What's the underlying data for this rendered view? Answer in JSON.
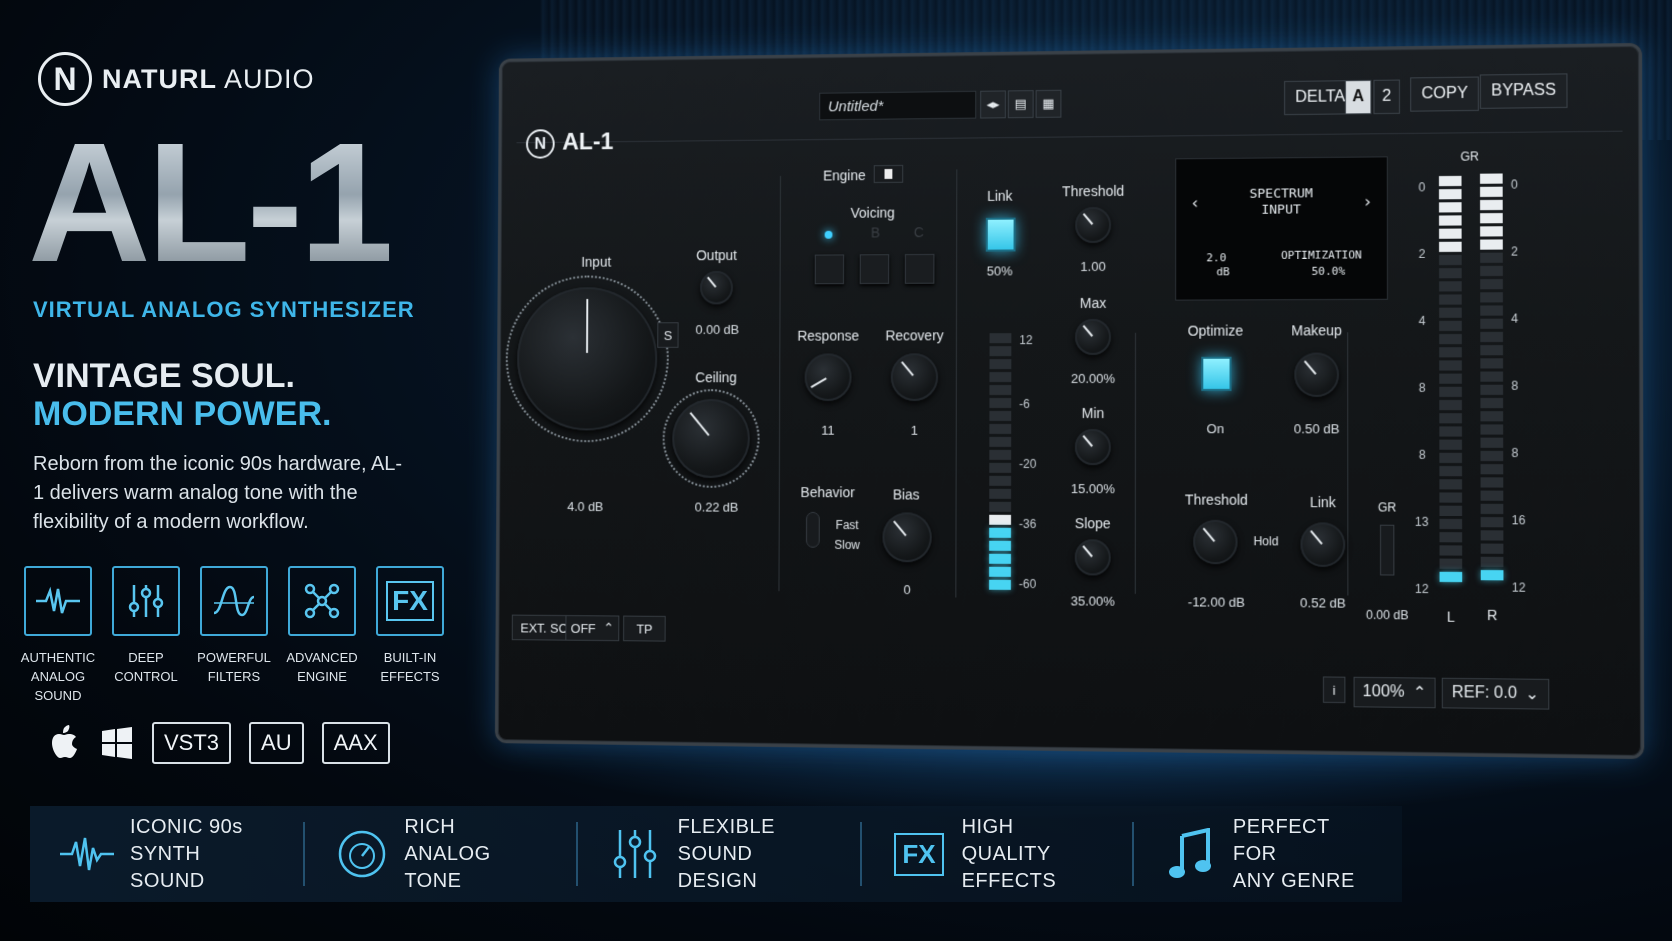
{
  "brand": {
    "name_bold": "NATURL",
    "name_light": " AUDIO",
    "logo_letter": "N"
  },
  "hero": {
    "title": "AL-1",
    "subtitle": "VIRTUAL ANALOG SYNTHESIZER",
    "tagline_line1": "VINTAGE SOUL.",
    "tagline_line2": "MODERN POWER.",
    "description": "Reborn from the iconic 90s hardware, AL-1 delivers warm analog tone with the flexibility of a modern workflow."
  },
  "features": [
    {
      "icon": "waveform-icon",
      "label_line1": "AUTHENTIC",
      "label_line2": "ANALOG SOUND"
    },
    {
      "icon": "sliders-icon",
      "label_line1": "DEEP",
      "label_line2": "CONTROL"
    },
    {
      "icon": "filter-icon",
      "label_line1": "POWERFUL",
      "label_line2": "FILTERS"
    },
    {
      "icon": "network-icon",
      "label_line1": "ADVANCED",
      "label_line2": "ENGINE"
    },
    {
      "icon": "fx-icon",
      "glyph": "FX",
      "label_line1": "BUILT-IN",
      "label_line2": "EFFECTS"
    }
  ],
  "platforms": {
    "apple": "apple-icon",
    "windows": "windows-icon",
    "formats": [
      "VST3",
      "AU",
      "AAX"
    ]
  },
  "bottom_bar": [
    {
      "icon": "waveform-icon",
      "line1": "ICONIC 90s",
      "line2": "SYNTH SOUND"
    },
    {
      "icon": "gauge-icon",
      "line1": "RICH",
      "line2": "ANALOG TONE"
    },
    {
      "icon": "sliders-icon",
      "line1": "FLEXIBLE",
      "line2": "SOUND DESIGN"
    },
    {
      "icon": "fx-icon",
      "line1": "HIGH QUALITY",
      "line2": "EFFECTS"
    },
    {
      "icon": "music-note-icon",
      "line1": "PERFECT FOR",
      "line2": "ANY GENRE"
    }
  ],
  "plugin": {
    "name": "AL-1",
    "preset_name": "Untitled*",
    "toolbar": {
      "delta": "DELTA",
      "a": "A",
      "b": "2",
      "copy": "COPY",
      "bypass": "BYPASS"
    },
    "input": {
      "label": "Input",
      "value": "4.0 dB"
    },
    "output": {
      "label": "Output",
      "value": "0.00 dB"
    },
    "ceiling": {
      "label": "Ceiling",
      "value": "0.22 dB"
    },
    "s_button": "S",
    "engine": {
      "label": "Engine"
    },
    "voicing": {
      "label": "Voicing",
      "options": [
        "A",
        "B",
        "C"
      ]
    },
    "response": {
      "label": "Response",
      "value": "11"
    },
    "recovery": {
      "label": "Recovery",
      "value": "1"
    },
    "behavior": {
      "label": "Behavior",
      "fast": "Fast",
      "slow": "Slow"
    },
    "bias": {
      "label": "Bias",
      "value": "0"
    },
    "link": {
      "label": "Link",
      "value": "50%"
    },
    "link_scale": [
      "12",
      "-6",
      "-20",
      "-36",
      "-60"
    ],
    "threshold": {
      "label": "Threshold",
      "value": "1.00"
    },
    "max": {
      "label": "Max",
      "value": "20.00%"
    },
    "min": {
      "label": "Min",
      "value": "15.00%"
    },
    "slope": {
      "label": "Slope",
      "value": "35.00%"
    },
    "display": {
      "line1": "SPECTRUM",
      "line2": "INPUT",
      "left_val": "2.0",
      "left_unit": "dB",
      "right_label": "OPTIMIZATION",
      "right_val": "50.0%"
    },
    "optimize": {
      "label": "Optimize",
      "value": "On"
    },
    "makeup": {
      "label": "Makeup",
      "value": "0.50 dB"
    },
    "threshold2": {
      "label": "Threshold",
      "value": "-12.00 dB"
    },
    "hold": "Hold",
    "link2": {
      "label": "Link",
      "value": "0.52 dB"
    },
    "gr": {
      "label": "GR",
      "value": "0.00 dB",
      "scale_left": [
        "0",
        "2",
        "4",
        "8",
        "8",
        "13",
        "12"
      ],
      "scale_right": [
        "0",
        "2",
        "4",
        "8",
        "8",
        "16",
        "12"
      ],
      "ch_l": "L",
      "ch_r": "R"
    },
    "footer": {
      "ext_sc": "EXT. SC",
      "off": "OFF",
      "tp": "TP",
      "info": "i",
      "zoom": "100%",
      "ref": "REF: 0.0"
    }
  }
}
